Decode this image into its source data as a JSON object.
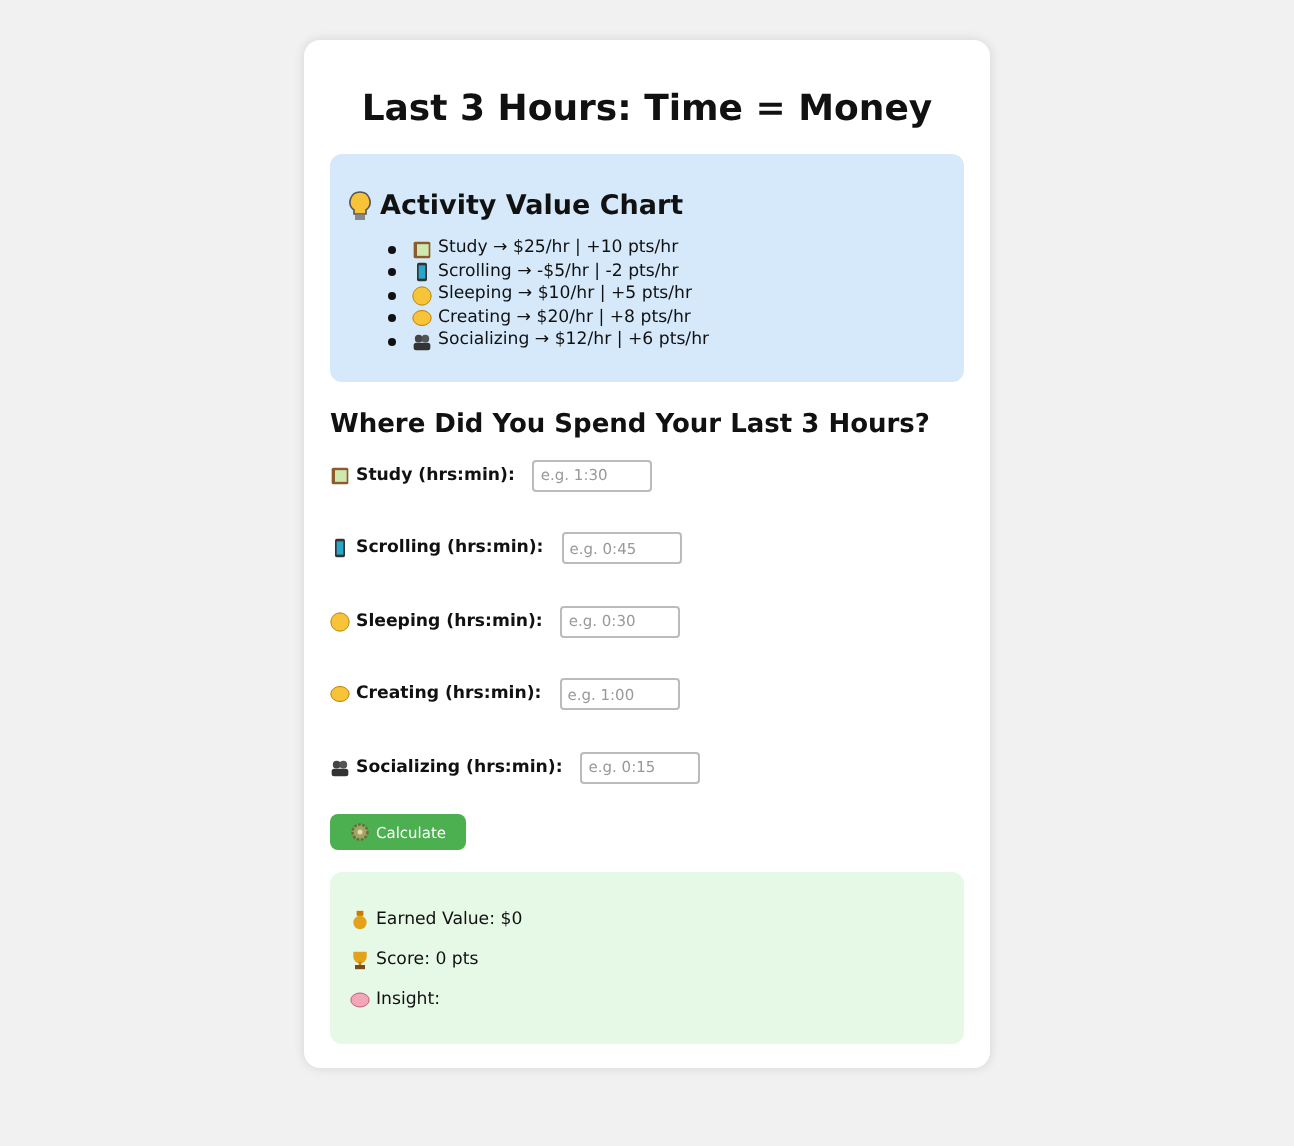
{
  "title": "Last 3 Hours: Time = Money",
  "chart": {
    "heading": "Activity Value Chart",
    "items": [
      {
        "text": "Study → $25/hr | +10 pts/hr"
      },
      {
        "text": "Scrolling → -$5/hr | -2 pts/hr"
      },
      {
        "text": "Sleeping → $10/hr | +5 pts/hr"
      },
      {
        "text": "Creating → $20/hr | +8 pts/hr"
      },
      {
        "text": "Socializing → $12/hr | +6 pts/hr"
      }
    ]
  },
  "form": {
    "heading": "Where Did You Spend Your Last 3 Hours?",
    "fields": [
      {
        "label": "Study (hrs:min):",
        "placeholder": "e.g. 1:30"
      },
      {
        "label": "Scrolling (hrs:min):",
        "placeholder": "e.g. 0:45"
      },
      {
        "label": "Sleeping (hrs:min):",
        "placeholder": "e.g. 0:30"
      },
      {
        "label": "Creating (hrs:min):",
        "placeholder": "e.g. 1:00"
      },
      {
        "label": "Socializing (hrs:min):",
        "placeholder": "e.g. 0:15"
      }
    ],
    "button": "Calculate"
  },
  "results": [
    {
      "text": "Earned Value: $0"
    },
    {
      "text": "Score: 0 pts"
    },
    {
      "text": "Insight:"
    }
  ]
}
